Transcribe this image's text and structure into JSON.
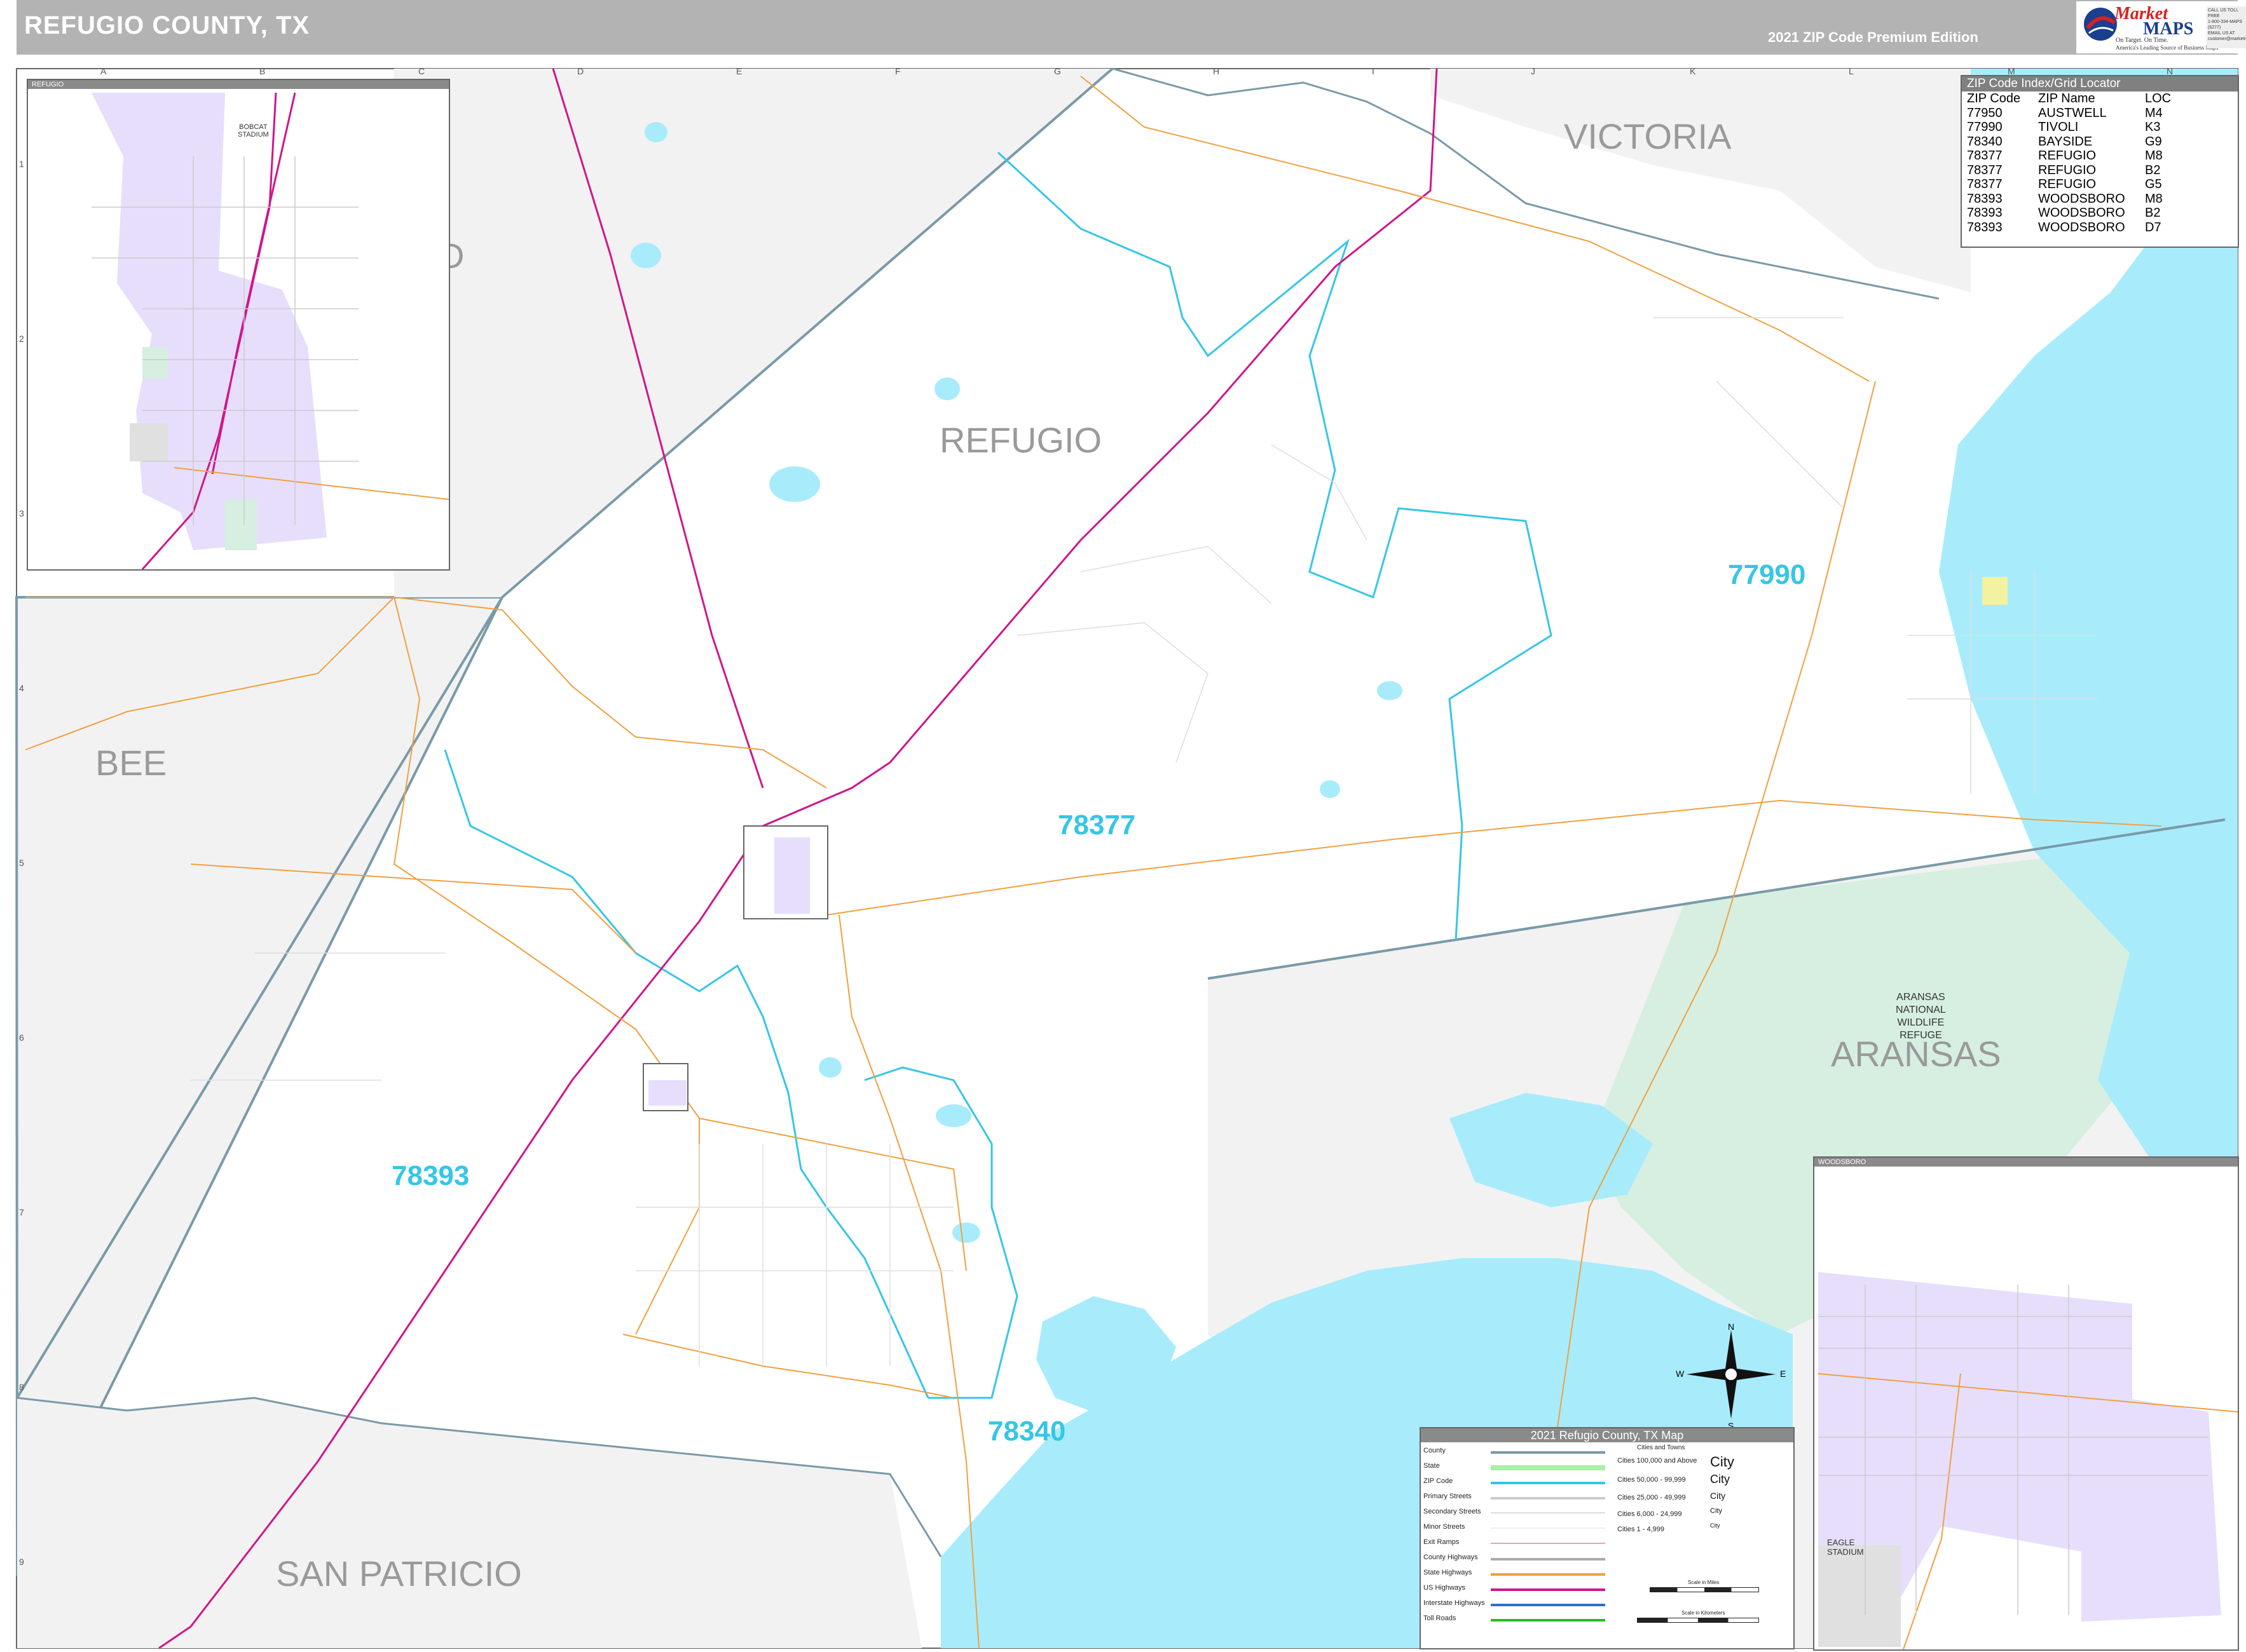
{
  "header": {
    "title": "REFUGIO COUNTY, TX",
    "edition": "2021 ZIP Code Premium Edition"
  },
  "logo": {
    "market": "Market",
    "maps": "MAPS",
    "tagline": "On Target.  On Time.",
    "subtagline": "America's Leading Source of Business Maps",
    "contact": [
      "CALL US TOLL FREE",
      "1-800-334-MAPS (6277)",
      "EMAIL US AT",
      "customer@marketmaps.com"
    ]
  },
  "grid": {
    "columns": [
      "A",
      "B",
      "C",
      "D",
      "E",
      "F",
      "G",
      "H",
      "I",
      "J",
      "K",
      "L",
      "M",
      "N"
    ],
    "rows": [
      "1",
      "2",
      "3",
      "4",
      "5",
      "6",
      "7",
      "8",
      "9"
    ]
  },
  "county_labels": {
    "victoria": "VICTORIA",
    "refugio": "REFUGIO",
    "bee": "BEE",
    "aransas": "ARANSAS",
    "san_patricio": "SAN PATRICIO",
    "goliad_partial": "D"
  },
  "zip_labels": [
    "77990",
    "78377",
    "78393",
    "78340"
  ],
  "features": {
    "refuge": [
      "ARANSAS",
      "NATIONAL",
      "WILDLIFE",
      "REFUGE"
    ],
    "bobcat_stadium": [
      "BOBCAT",
      "STADIUM"
    ],
    "eagle_stadium": [
      "EAGLE",
      "STADIUM"
    ]
  },
  "zip_index": {
    "title": "ZIP Code Index/Grid Locator",
    "columns": [
      "ZIP Code",
      "ZIP Name",
      "LOC"
    ],
    "rows": [
      [
        "77950",
        "AUSTWELL",
        "M4"
      ],
      [
        "77990",
        "TIVOLI",
        "K3"
      ],
      [
        "78340",
        "BAYSIDE",
        "G9"
      ],
      [
        "78377",
        "REFUGIO",
        "M8"
      ],
      [
        "78377",
        "REFUGIO",
        "B2"
      ],
      [
        "78377",
        "REFUGIO",
        "G5"
      ],
      [
        "78393",
        "WOODSBORO",
        "M8"
      ],
      [
        "78393",
        "WOODSBORO",
        "B2"
      ],
      [
        "78393",
        "WOODSBORO",
        "D7"
      ]
    ]
  },
  "insets": {
    "refugio": {
      "title": "REFUGIO"
    },
    "woodsboro": {
      "title": "WOODSBORO"
    }
  },
  "legend": {
    "title": "2021 Refugio County, TX Map",
    "items": [
      {
        "name": "County",
        "color": "#7a9aa8"
      },
      {
        "name": "State",
        "color": "#a8f0a8"
      },
      {
        "name": "ZIP Code",
        "color": "#36c6e6"
      },
      {
        "name": "Primary Streets",
        "color": "#cccccc"
      },
      {
        "name": "Secondary Streets",
        "color": "#dddddd"
      },
      {
        "name": "Minor Streets",
        "color": "#eeeeee"
      },
      {
        "name": "Exit Ramps",
        "color": "#f4a0b0"
      },
      {
        "name": "County Highways",
        "color": "#aaaaaa"
      },
      {
        "name": "State Highways",
        "color": "#f0a040"
      },
      {
        "name": "US Highways",
        "color": "#d0158a"
      },
      {
        "name": "Interstate Highways",
        "color": "#2f6fd0"
      },
      {
        "name": "Toll Roads",
        "color": "#20c020"
      }
    ],
    "cities_header": "Cities and Towns",
    "cities": [
      {
        "range": "Cities 100,000 and Above",
        "sample": "City"
      },
      {
        "range": "Cities 50,000 - 99,999",
        "sample": "City"
      },
      {
        "range": "Cities 25,000 - 49,999",
        "sample": "City"
      },
      {
        "range": "Cities 6,000 - 24,999",
        "sample": "City"
      },
      {
        "range": "Cities 1 - 4,999",
        "sample": "City"
      }
    ],
    "scale_miles": "Scale in Miles",
    "scale_km": "Scale in Kilometers"
  },
  "compass": {
    "n": "N",
    "s": "S",
    "e": "E",
    "w": "W"
  },
  "colors": {
    "water": "#a8ecfc",
    "outside": "#f2f2f2",
    "zip_line": "#36c6e6",
    "us_highway": "#d0158a",
    "state_highway": "#f0a040",
    "county_line": "#7a9aa8",
    "refuge": "#d6efe0",
    "city_fill": "#e7defc"
  }
}
